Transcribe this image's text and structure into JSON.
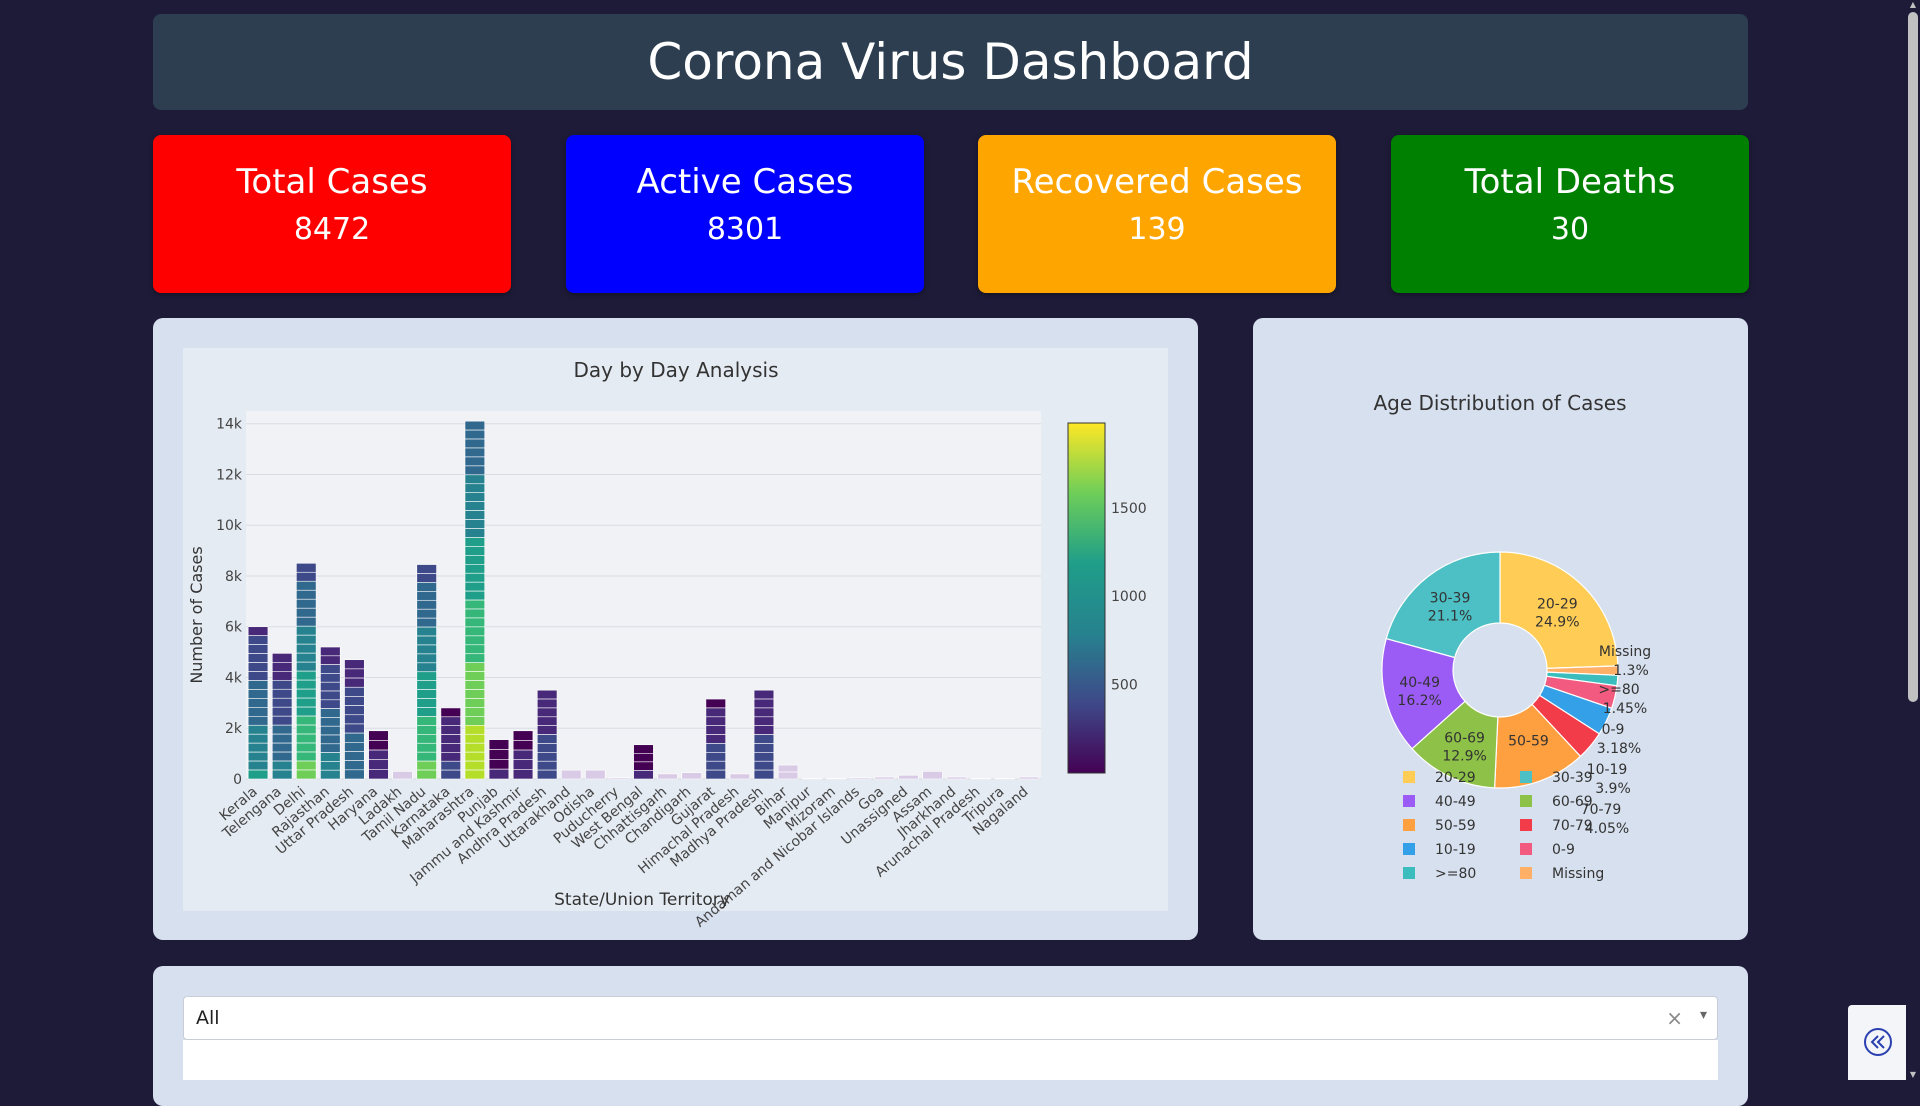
{
  "header": {
    "title": "Corona Virus Dashboard"
  },
  "cards": [
    {
      "title": "Total Cases",
      "value": "8472",
      "color": "#ff0000"
    },
    {
      "title": "Active Cases",
      "value": "8301",
      "color": "#0000ff"
    },
    {
      "title": "Recovered Cases",
      "value": "139",
      "color": "#ffa500"
    },
    {
      "title": "Total Deaths",
      "value": "30",
      "color": "#008000"
    }
  ],
  "chart_data": [
    {
      "type": "bar",
      "title": "Day by Day Analysis",
      "xlabel": "State/Union Territory",
      "ylabel": "Number of Cases",
      "ylim": [
        0,
        14500
      ],
      "yticks": [
        0,
        2000,
        4000,
        6000,
        8000,
        10000,
        12000,
        14000
      ],
      "ytick_labels": [
        "0",
        "2k",
        "4k",
        "6k",
        "8k",
        "10k",
        "12k",
        "14k"
      ],
      "categories": [
        "Kerala",
        "Telengana",
        "Delhi",
        "Rajasthan",
        "Uttar Pradesh",
        "Haryana",
        "Ladakh",
        "Tamil Nadu",
        "Karnataka",
        "Maharashtra",
        "Punjab",
        "Jammu and Kashmir",
        "Andhra Pradesh",
        "Uttarakhand",
        "Odisha",
        "Puducherry",
        "West Bengal",
        "Chhattisgarh",
        "Chandigarh",
        "Gujarat",
        "Himachal Pradesh",
        "Madhya Pradesh",
        "Bihar",
        "Manipur",
        "Mizoram",
        "Andaman and Nicobar Islands",
        "Goa",
        "Unassigned",
        "Assam",
        "Jharkhand",
        "Arunachal Pradesh",
        "Tripura",
        "Nagaland"
      ],
      "values": [
        6000,
        4950,
        8500,
        5200,
        4700,
        1900,
        300,
        8450,
        2800,
        14100,
        1550,
        1900,
        3500,
        350,
        350,
        50,
        1350,
        200,
        250,
        3150,
        200,
        3500,
        550,
        20,
        20,
        50,
        80,
        150,
        300,
        80,
        20,
        20,
        80
      ],
      "colorbar": {
        "ticks": [
          500,
          1000,
          1500
        ],
        "colors": [
          "#0d0887",
          "#46039f",
          "#7201a8",
          "#9c179e",
          "#bd3786",
          "#d8576b",
          "#ed7953",
          "#fb9f3a",
          "#fdca26",
          "#f0f921"
        ],
        "scale_colors": [
          "#440154",
          "#482878",
          "#3e4989",
          "#31688e",
          "#26828e",
          "#1f9e89",
          "#35b779",
          "#6ece58",
          "#b5de2b",
          "#fde725"
        ]
      }
    },
    {
      "type": "pie",
      "title": "Age Distribution of Cases",
      "slices": [
        {
          "label": "20-29",
          "value": 24.9,
          "pct": "24.9%",
          "color": "#ffcc55"
        },
        {
          "label": "Missing",
          "value": 1.3,
          "pct": "1.3%",
          "color": "#ffb066"
        },
        {
          "label": ">=80",
          "value": 1.45,
          "pct": "1.45%",
          "color": "#3cbdbd"
        },
        {
          "label": "0-9",
          "value": 3.18,
          "pct": "3.18%",
          "color": "#f25a7f"
        },
        {
          "label": "10-19",
          "value": 3.9,
          "pct": "3.9%",
          "color": "#33a0e8"
        },
        {
          "label": "70-79",
          "value": 4.05,
          "pct": "4.05%",
          "color": "#f23c4a"
        },
        {
          "label": "50-59",
          "value": 12.9,
          "pct": "",
          "color": "#ffa040"
        },
        {
          "label": "60-69",
          "value": 12.9,
          "pct": "12.9%",
          "color": "#8dc147"
        },
        {
          "label": "40-49",
          "value": 16.2,
          "pct": "16.2%",
          "color": "#9b5bf5"
        },
        {
          "label": "30-39",
          "value": 21.1,
          "pct": "21.1%",
          "color": "#4cc0c4"
        }
      ],
      "legend": [
        "20-29",
        "30-39",
        "40-49",
        "60-69",
        "50-59",
        "70-79",
        "10-19",
        "0-9",
        ">=80",
        "Missing"
      ]
    }
  ],
  "dropdown": {
    "value": "All",
    "clear": "×",
    "arrow": "▾"
  },
  "collapse_button": {
    "icon": "double-chevron-left-icon"
  }
}
